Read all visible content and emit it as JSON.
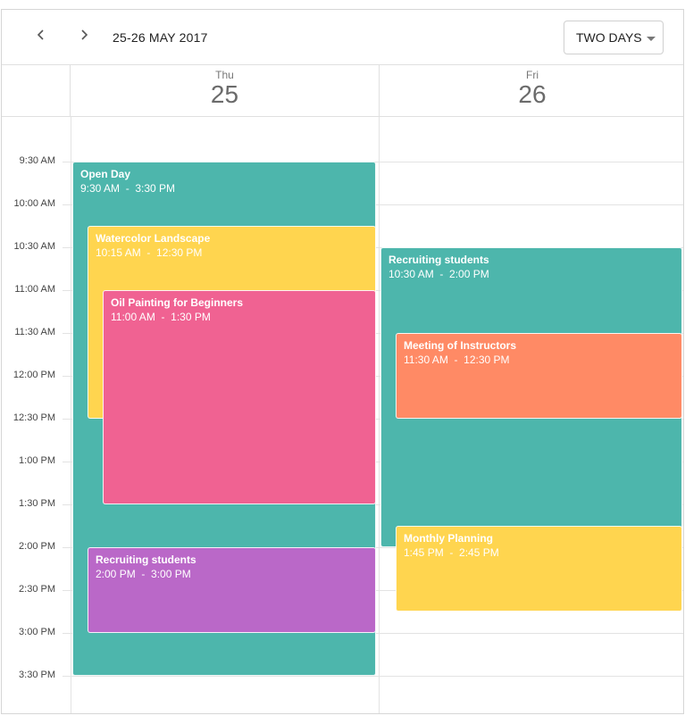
{
  "toolbar": {
    "prev_icon": "chevron-left-icon",
    "next_icon": "chevron-right-icon",
    "date_range": "25-26 MAY 2017",
    "view_selector": {
      "selected": "TWO DAYS",
      "icon": "caret-down-icon"
    }
  },
  "days": [
    {
      "dow": "Thu",
      "date": "25"
    },
    {
      "dow": "Fri",
      "date": "26"
    }
  ],
  "time_slots": [
    "9:30 AM",
    "10:00 AM",
    "10:30 AM",
    "11:00 AM",
    "11:30 AM",
    "12:00 PM",
    "12:30 PM",
    "1:00 PM",
    "1:30 PM",
    "2:00 PM",
    "2:30 PM",
    "3:00 PM",
    "3:30 PM"
  ],
  "colors": {
    "teal": "#4db6ac",
    "yellow": "#ffd54f",
    "pink": "#f06292",
    "purple": "#ba68c8",
    "orange": "#ff8a65"
  },
  "appointments": [
    {
      "day": 0,
      "title": "Open Day",
      "time": "9:30 AM  -  3:30 PM",
      "start": 9.5,
      "end": 15.5,
      "indent": 0,
      "color": "#4db6ac"
    },
    {
      "day": 0,
      "title": "Watercolor Landscape",
      "time": "10:15 AM  -  12:30 PM",
      "start": 10.25,
      "end": 12.5,
      "indent": 1,
      "color": "#ffd54f"
    },
    {
      "day": 0,
      "title": "Oil Painting for Beginners",
      "time": "11:00 AM  -  1:30 PM",
      "start": 11,
      "end": 13.5,
      "indent": 2,
      "color": "#f06292"
    },
    {
      "day": 0,
      "title": "Recruiting students",
      "time": "2:00 PM  -  3:00 PM",
      "start": 14,
      "end": 15,
      "indent": 1,
      "color": "#ba68c8"
    },
    {
      "day": 1,
      "title": "Recruiting students",
      "time": "10:30 AM  -  2:00 PM",
      "start": 10.5,
      "end": 14,
      "indent": 0,
      "color": "#4db6ac"
    },
    {
      "day": 1,
      "title": "Meeting of Instructors",
      "time": "11:30 AM  -  12:30 PM",
      "start": 11.5,
      "end": 12.5,
      "indent": 1,
      "color": "#ff8a65"
    },
    {
      "day": 1,
      "title": "Monthly Planning",
      "time": "1:45 PM  -  2:45 PM",
      "start": 13.75,
      "end": 14.75,
      "indent": 1,
      "color": "#ffd54f"
    }
  ]
}
